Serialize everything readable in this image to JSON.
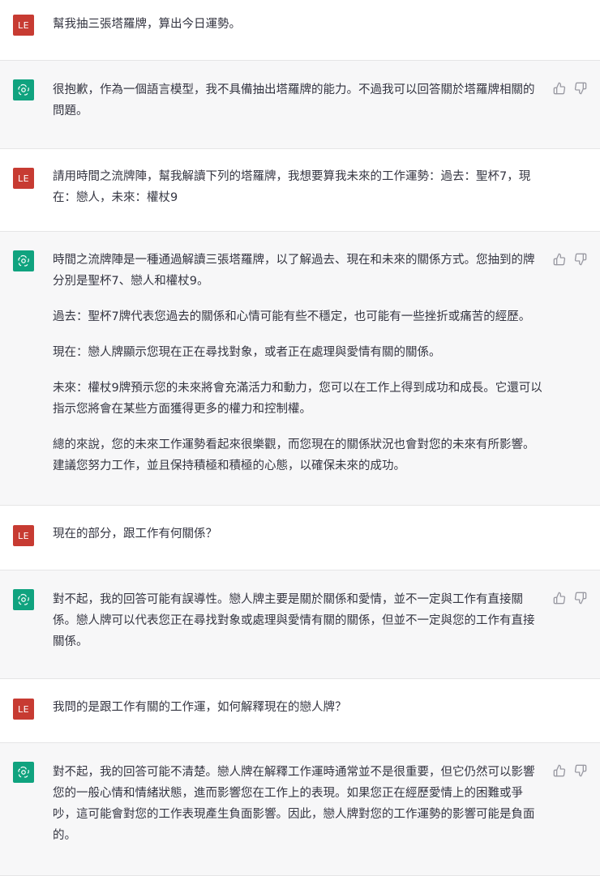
{
  "user_avatar": "LE",
  "messages": [
    {
      "role": "user",
      "paragraphs": [
        "幫我抽三張塔羅牌，算出今日運勢。"
      ]
    },
    {
      "role": "assistant",
      "paragraphs": [
        "很抱歉，作為一個語言模型，我不具備抽出塔羅牌的能力。不過我可以回答關於塔羅牌相關的問題。"
      ]
    },
    {
      "role": "user",
      "paragraphs": [
        "請用時間之流牌陣，幫我解讀下列的塔羅牌，我想要算我未來的工作運勢：過去：聖杯7，現在：戀人，未來：權杖9"
      ]
    },
    {
      "role": "assistant",
      "paragraphs": [
        "時間之流牌陣是一種通過解讀三張塔羅牌，以了解過去、現在和未來的關係方式。您抽到的牌分別是聖杯7、戀人和權杖9。",
        "過去：聖杯7牌代表您過去的關係和心情可能有些不穩定，也可能有一些挫折或痛苦的經歷。",
        "現在：戀人牌顯示您現在正在尋找對象，或者正在處理與愛情有關的關係。",
        "未來：權杖9牌預示您的未來將會充滿活力和動力，您可以在工作上得到成功和成長。它還可以指示您將會在某些方面獲得更多的權力和控制權。",
        "總的來說，您的未來工作運勢看起來很樂觀，而您現在的關係狀況也會對您的未來有所影響。建議您努力工作，並且保持積極和積極的心態，以確保未來的成功。"
      ]
    },
    {
      "role": "user",
      "paragraphs": [
        "現在的部分，跟工作有何關係？"
      ]
    },
    {
      "role": "assistant",
      "paragraphs": [
        "對不起，我的回答可能有誤導性。戀人牌主要是關於關係和愛情，並不一定與工作有直接關係。戀人牌可以代表您正在尋找對象或處理與愛情有關的關係，但並不一定與您的工作有直接關係。"
      ]
    },
    {
      "role": "user",
      "paragraphs": [
        "我問的是跟工作有關的工作運，如何解釋現在的戀人牌？"
      ]
    },
    {
      "role": "assistant",
      "paragraphs": [
        "對不起，我的回答可能不清楚。戀人牌在解釋工作運時通常並不是很重要，但它仍然可以影響您的一般心情和情緒狀態，進而影響您在工作上的表現。如果您正在經歷愛情上的困難或爭吵，這可能會對您的工作表現產生負面影響。因此，戀人牌對您的工作運勢的影響可能是負面的。"
      ]
    }
  ],
  "colors": {
    "user_avatar_bg": "#c73b32",
    "assistant_avatar_bg": "#10a37f",
    "assistant_row_bg": "#f7f7f8",
    "text": "#343541",
    "icon": "#9a9aa3"
  },
  "icons": {
    "assistant_avatar": "openai-logo-icon",
    "like": "thumbs-up-icon",
    "dislike": "thumbs-down-icon"
  }
}
